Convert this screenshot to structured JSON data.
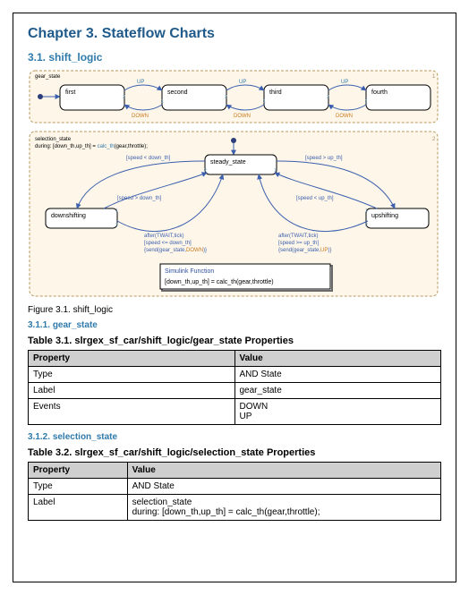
{
  "chapter": {
    "title": "Chapter 3. Stateflow Charts"
  },
  "section": {
    "num": "3.1.",
    "title": "shift_logic"
  },
  "fig1": {
    "gear_state_label": "gear_state",
    "gears": [
      "first",
      "second",
      "third",
      "fourth"
    ],
    "up_label": "UP",
    "down_label": "DOWN",
    "sel_state_title": "selection_state",
    "sel_state_during": "during: [down_th,up_th] = calc_th(gear,throttle);",
    "sel_calc_fn": "calc_th",
    "sel_calc_args": "(gear,throttle);",
    "center_state": "steady_state",
    "left_state": "downshifting",
    "right_state": "upshifting",
    "cond_speed_lt_down": "[speed < down_th]",
    "cond_speed_gt_down": "[speed > down_th]",
    "cond_speed_gt_up": "[speed > up_th]",
    "cond_speed_lt_up": "[speed < up_th]",
    "after_left_l1": "after(TWAIT,tick)",
    "after_left_l2": "[speed <= down_th]",
    "after_left_l3a": "{send(gear_state,",
    "after_left_l3b": "DOWN",
    "after_left_l3c": ")}",
    "after_right_l1": "after(TWAIT,tick)",
    "after_right_l2": "[speed >= up_th]",
    "after_right_l3a": "{send(gear_state,",
    "after_right_l3b": "UP",
    "after_right_l3c": ")}",
    "simfn_title": "Simulink Function",
    "simfn_body": "[down_th,up_th] = calc_th(gear,throttle)",
    "caption": "Figure 3.1. shift_logic"
  },
  "sub1": {
    "num": "3.1.1.",
    "title": "gear_state"
  },
  "table1": {
    "title": "Table 3.1. slrgex_sf_car/shift_logic/gear_state Properties",
    "h1": "Property",
    "h2": "Value",
    "r1c1": "Type",
    "r1c2": "AND State",
    "r2c1": "Label",
    "r2c2": "gear_state",
    "r3c1": "Events",
    "r3c2a": "DOWN",
    "r3c2b": "UP"
  },
  "sub2": {
    "num": "3.1.2.",
    "title": "selection_state"
  },
  "table2": {
    "title": "Table 3.2. slrgex_sf_car/shift_logic/selection_state Properties",
    "h1": "Property",
    "h2": "Value",
    "r1c1": "Type",
    "r1c2": "AND State",
    "r2c1": "Label",
    "r2c2a": "selection_state",
    "r2c2b": "during: [down_th,up_th] = calc_th(gear,throttle);"
  }
}
